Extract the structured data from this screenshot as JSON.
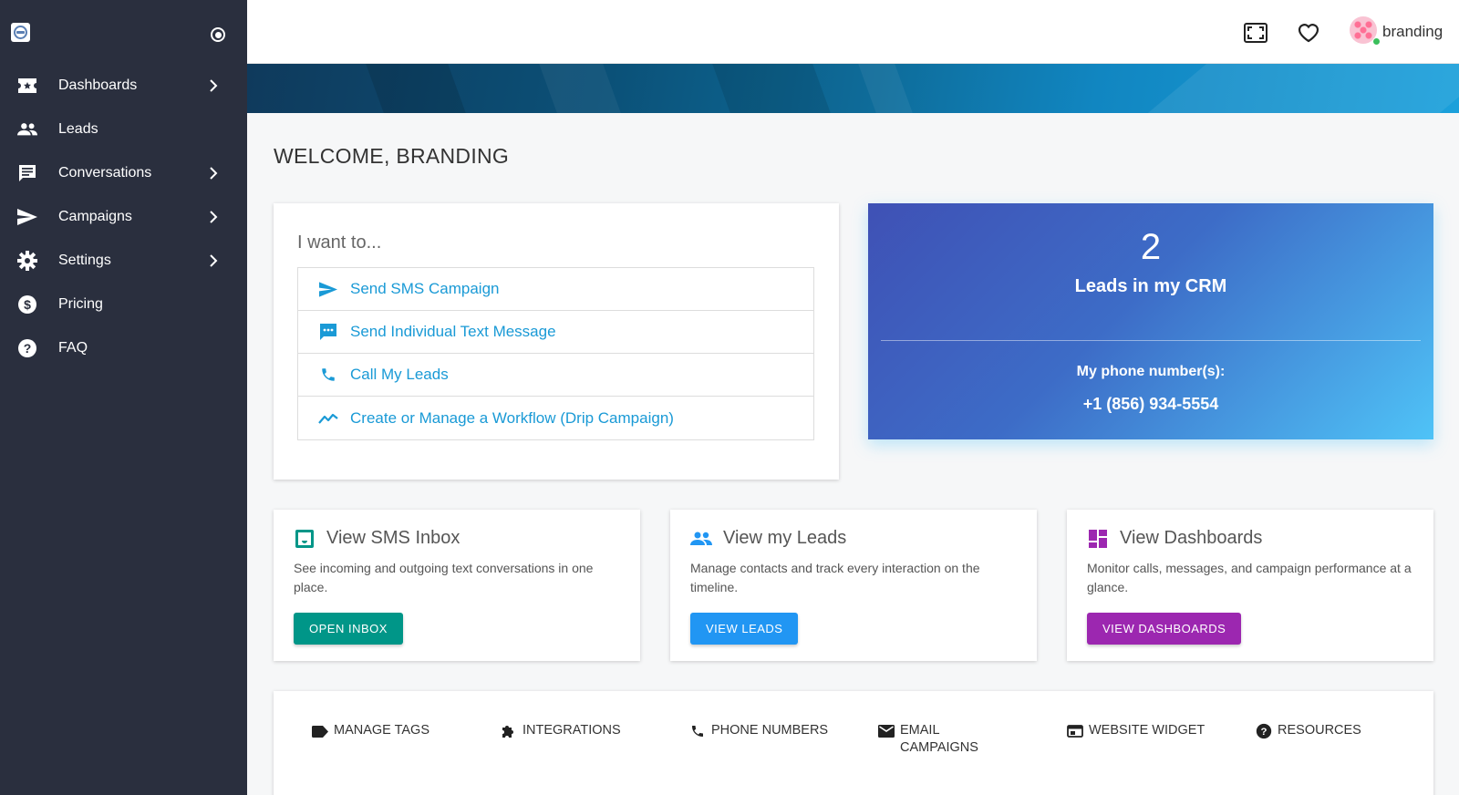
{
  "sidebar": {
    "items": [
      {
        "label": "Dashboards",
        "icon": "ticket-icon",
        "has_children": true
      },
      {
        "label": "Leads",
        "icon": "people-icon",
        "has_children": false
      },
      {
        "label": "Conversations",
        "icon": "chat-icon",
        "has_children": true
      },
      {
        "label": "Campaigns",
        "icon": "send-icon",
        "has_children": true
      },
      {
        "label": "Settings",
        "icon": "gear-icon",
        "has_children": true
      },
      {
        "label": "Pricing",
        "icon": "dollar-icon",
        "has_children": false
      },
      {
        "label": "FAQ",
        "icon": "help-icon",
        "has_children": false
      }
    ]
  },
  "header": {
    "username": "branding"
  },
  "main": {
    "welcome": "WELCOME, BRANDING",
    "iwant": {
      "title": "I want to...",
      "items": [
        {
          "label": "Send SMS Campaign",
          "icon": "send-icon"
        },
        {
          "label": "Send Individual Text Message",
          "icon": "sms-icon"
        },
        {
          "label": "Call My Leads",
          "icon": "phone-icon"
        },
        {
          "label": "Create or Manage a Workflow (Drip Campaign)",
          "icon": "trending-icon"
        }
      ]
    },
    "stats": {
      "count": "2",
      "count_label": "Leads in my CRM",
      "phone_label": "My phone number(s):",
      "phone": "+1 (856) 934-5554"
    },
    "features": [
      {
        "title": "View SMS Inbox",
        "desc": "See incoming and outgoing text conversations in one place.",
        "button": "OPEN INBOX",
        "color": "#009688",
        "icon": "inbox-icon"
      },
      {
        "title": "View my Leads",
        "desc": "Manage contacts and track every interaction on the timeline.",
        "button": "VIEW LEADS",
        "color": "#2196f3",
        "icon": "people-icon"
      },
      {
        "title": "View Dashboards",
        "desc": "Monitor calls, messages, and campaign performance at a glance.",
        "button": "VIEW DASHBOARDS",
        "color": "#9c27b0",
        "icon": "dashboard-icon"
      }
    ],
    "tools": [
      {
        "label": "MANAGE TAGS",
        "icon": "tag-icon"
      },
      {
        "label": "INTEGRATIONS",
        "icon": "puzzle-icon"
      },
      {
        "label": "PHONE NUMBERS",
        "icon": "phone-icon"
      },
      {
        "label": "EMAIL CAMPAIGNS",
        "icon": "email-icon"
      },
      {
        "label": "WEBSITE WIDGET",
        "icon": "widget-icon"
      },
      {
        "label": "RESOURCES",
        "icon": "help-icon"
      }
    ]
  },
  "colors": {
    "sidebar_bg": "#2a2f3e",
    "link": "#1a9ad6",
    "inbox": "#009688",
    "leads": "#2196f3",
    "dashboards": "#9c27b0"
  }
}
